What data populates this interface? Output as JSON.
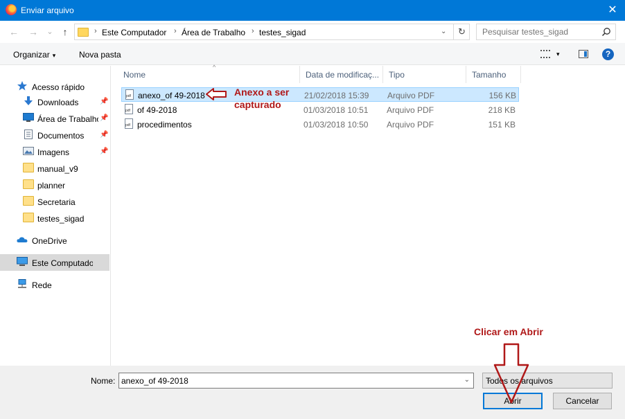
{
  "window": {
    "title": "Enviar arquivo",
    "close_glyph": "✕"
  },
  "nav": {
    "back": "←",
    "forward": "→",
    "recent": "⌄",
    "up": "↑"
  },
  "address": {
    "crumbs": [
      "Este Computador",
      "Área de Trabalho",
      "testes_sigad"
    ],
    "separator": "›",
    "dropdown": "⌄",
    "refresh": "↻"
  },
  "search": {
    "placeholder": "Pesquisar testes_sigad",
    "value": ""
  },
  "toolbar": {
    "organize_label": "Organizar",
    "organize_caret": "▾",
    "new_folder_label": "Nova pasta",
    "view_caret": "▾",
    "help_label": "?"
  },
  "sidebar": {
    "quick_access": "Acesso rápido",
    "pin": "📌",
    "items": [
      {
        "label": "Downloads",
        "icon": "download-arrow-icon",
        "pinned": true
      },
      {
        "label": "Área de Trabalho",
        "icon": "desktop-icon",
        "pinned": true
      },
      {
        "label": "Documentos",
        "icon": "documents-icon",
        "pinned": true
      },
      {
        "label": "Imagens",
        "icon": "images-icon",
        "pinned": true
      },
      {
        "label": "manual_v9",
        "icon": "folder-icon",
        "pinned": false
      },
      {
        "label": "planner",
        "icon": "folder-icon",
        "pinned": false
      },
      {
        "label": "Secretaria",
        "icon": "folder-icon",
        "pinned": false
      },
      {
        "label": "testes_sigad",
        "icon": "folder-icon",
        "pinned": false
      }
    ],
    "onedrive": "OneDrive",
    "this_pc": "Este Computador",
    "network": "Rede"
  },
  "columns": {
    "name": "Nome",
    "modified": "Data de modificaç...",
    "type": "Tipo",
    "size": "Tamanho",
    "sort_caret": "^"
  },
  "files": [
    {
      "name": "anexo_of 49-2018",
      "modified": "21/02/2018 15:39",
      "type": "Arquivo PDF",
      "size": "156 KB",
      "selected": true
    },
    {
      "name": "of 49-2018",
      "modified": "01/03/2018 10:51",
      "type": "Arquivo PDF",
      "size": "218 KB",
      "selected": false
    },
    {
      "name": "procedimentos",
      "modified": "01/03/2018 10:50",
      "type": "Arquivo PDF",
      "size": "151 KB",
      "selected": false
    }
  ],
  "annotations": {
    "attachment_note": "Anexo a ser capturado",
    "click_note": "Clicar em Abrir",
    "color": "#b01818"
  },
  "footer": {
    "name_label": "Nome:",
    "name_value": "anexo_of 49-2018",
    "dropdown": "⌄",
    "filter_value": "Todos os arquivos",
    "open_label": "Abrir",
    "cancel_label": "Cancelar"
  },
  "colors": {
    "titlebar": "#0078d7",
    "selection": "#cce8ff",
    "selection_border": "#99d1ff"
  }
}
